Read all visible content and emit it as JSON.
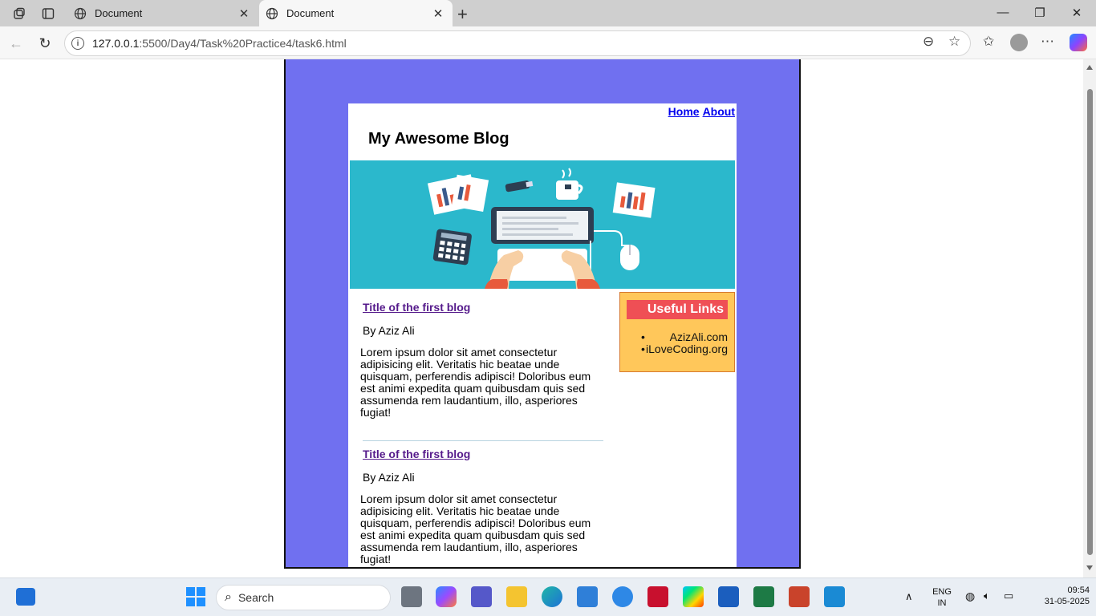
{
  "browser": {
    "tabs": [
      {
        "title": "Document",
        "active": false
      },
      {
        "title": "Document",
        "active": true
      }
    ],
    "url_host": "127.0.0.1",
    "url_path": ":5500/Day4/Task%20Practice4/task6.html"
  },
  "page": {
    "nav": {
      "home": "Home",
      "about": "About"
    },
    "blog_title": "My Awesome Blog",
    "posts": [
      {
        "title": "Title of the first blog",
        "author": "By Aziz Ali",
        "body": "Lorem ipsum dolor sit amet consectetur adipisicing elit. Veritatis hic beatae unde quisquam, perferendis adipisci! Doloribus eum est animi expedita quam quibusdam quis sed assumenda rem laudantium, illo, asperiores fugiat!"
      },
      {
        "title": "Title of the first blog",
        "author": "By Aziz Ali",
        "body": "Lorem ipsum dolor sit amet consectetur adipisicing elit. Veritatis hic beatae unde quisquam, perferendis adipisci! Doloribus eum est animi expedita quam quibusdam quis sed assumenda rem laudantium, illo, asperiores fugiat!"
      }
    ],
    "sidebar": {
      "heading": "Useful Links",
      "links": [
        "AzizAli.com",
        "iLoveCoding.org"
      ]
    },
    "colors": {
      "outer_bg": "#7070f0",
      "hero_bg": "#2bb8cc",
      "sidebar_bg": "#ffc75a",
      "sidebar_head": "#ef4f55"
    }
  },
  "taskbar": {
    "search_placeholder": "Search",
    "lang": "ENG",
    "region": "IN",
    "time": "09:54",
    "date": "31-05-2025"
  }
}
